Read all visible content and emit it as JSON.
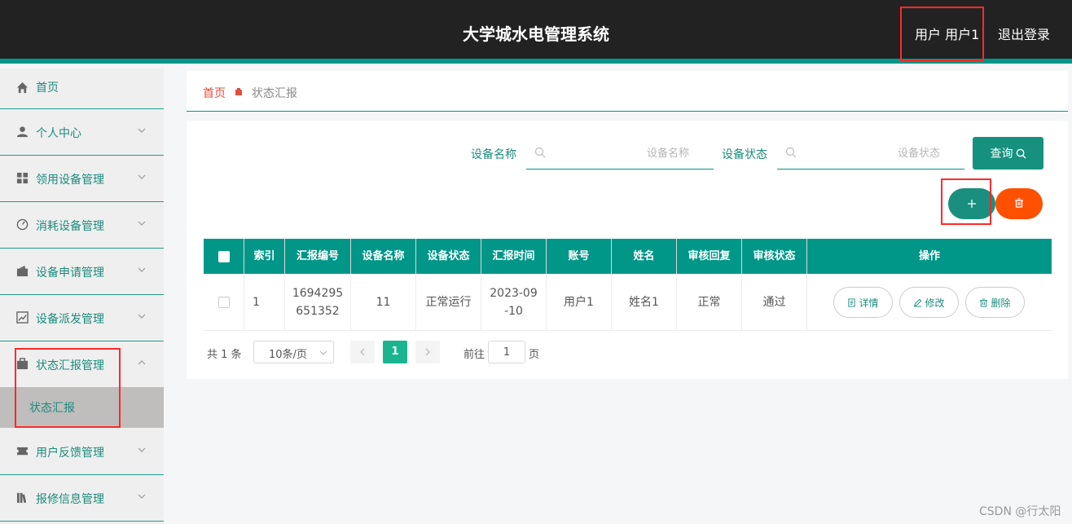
{
  "header": {
    "title": "大学城水电管理系统",
    "user_label": "用户 用户1",
    "logout_label": "退出登录"
  },
  "sidebar": {
    "items": [
      {
        "label": "首页",
        "icon": "home-icon"
      },
      {
        "label": "个人中心",
        "icon": "user-icon"
      },
      {
        "label": "领用设备管理",
        "icon": "grid-icon"
      },
      {
        "label": "消耗设备管理",
        "icon": "gauge-icon"
      },
      {
        "label": "设备申请管理",
        "icon": "wallet-icon"
      },
      {
        "label": "设备派发管理",
        "icon": "chart-icon"
      },
      {
        "label": "状态汇报管理",
        "icon": "briefcase-icon"
      },
      {
        "label": "用户反馈管理",
        "icon": "ticket-icon"
      },
      {
        "label": "报修信息管理",
        "icon": "books-icon"
      }
    ],
    "active_sub": "状态汇报"
  },
  "breadcrumb": {
    "home": "首页",
    "current": "状态汇报"
  },
  "search": {
    "name_label": "设备名称",
    "name_placeholder": "设备名称",
    "status_label": "设备状态",
    "status_placeholder": "设备状态",
    "query_label": "查询"
  },
  "table": {
    "columns": [
      "索引",
      "汇报编号",
      "设备名称",
      "设备状态",
      "汇报时间",
      "账号",
      "姓名",
      "审核回复",
      "审核状态",
      "操作"
    ],
    "rows": [
      {
        "index": "1",
        "report_no": "1694295651352",
        "report_no_l1": "1694295",
        "report_no_l2": "651352",
        "device_name": "11",
        "device_status": "正常运行",
        "time_l1": "2023-09",
        "time_l2": "-10",
        "account": "用户1",
        "name": "姓名1",
        "reply": "正常",
        "review_status": "通过"
      }
    ],
    "actions": {
      "detail": "详情",
      "edit": "修改",
      "delete": "删除"
    }
  },
  "pagination": {
    "total": "共 1 条",
    "page_size": "10条/页",
    "current_page": "1",
    "goto_label": "前往",
    "goto_value": "1",
    "page_suffix": "页"
  },
  "watermark": "CSDN @行太阳",
  "colors": {
    "primary": "#009688",
    "danger": "#ff5000",
    "header_bg": "#222222",
    "highlight": "#ff2a2a"
  }
}
